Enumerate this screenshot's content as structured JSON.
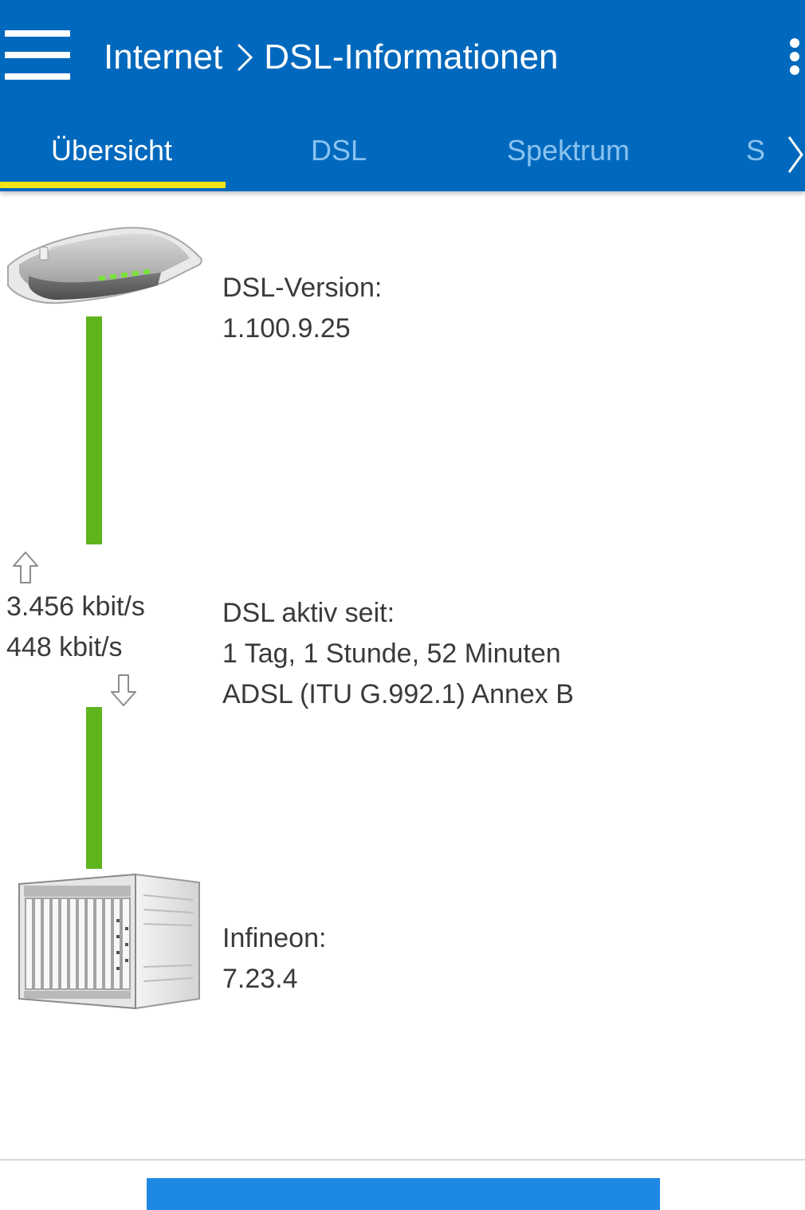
{
  "header": {
    "breadcrumb_parent": "Internet",
    "breadcrumb_current": "DSL-Informationen"
  },
  "tabs": [
    {
      "label": "Übersicht",
      "active": true
    },
    {
      "label": "DSL",
      "active": false
    },
    {
      "label": "Spektrum",
      "active": false
    },
    {
      "label": "S",
      "active": false
    }
  ],
  "overview": {
    "dsl_version_label": "DSL-Version:",
    "dsl_version_value": "1.100.9.25",
    "upstream_rate": "3.456 kbit/s",
    "downstream_rate": "448 kbit/s",
    "active_since_label": "DSL aktiv seit:",
    "active_since_value": "1 Tag, 1 Stunde, 52 Minuten",
    "line_mode": "ADSL (ITU G.992.1) Annex B",
    "dslam_vendor_label": "Infineon:",
    "dslam_version_value": "7.23.4"
  },
  "icons": {
    "menu": "hamburger-icon",
    "overflow": "more-vert-icon",
    "breadcrumb_separator": "chevron-right-icon",
    "tab_scroll": "chevron-right-icon",
    "upstream": "arrow-up-icon",
    "downstream": "arrow-down-icon",
    "router": "router-icon",
    "dslam": "dslam-icon"
  },
  "colors": {
    "app_bar": "#0069BD",
    "tab_indicator": "#F5E31A",
    "link_line": "#5FB41E",
    "inactive_tab": "#8AC3F0",
    "bottom_button": "#1E88E5"
  }
}
